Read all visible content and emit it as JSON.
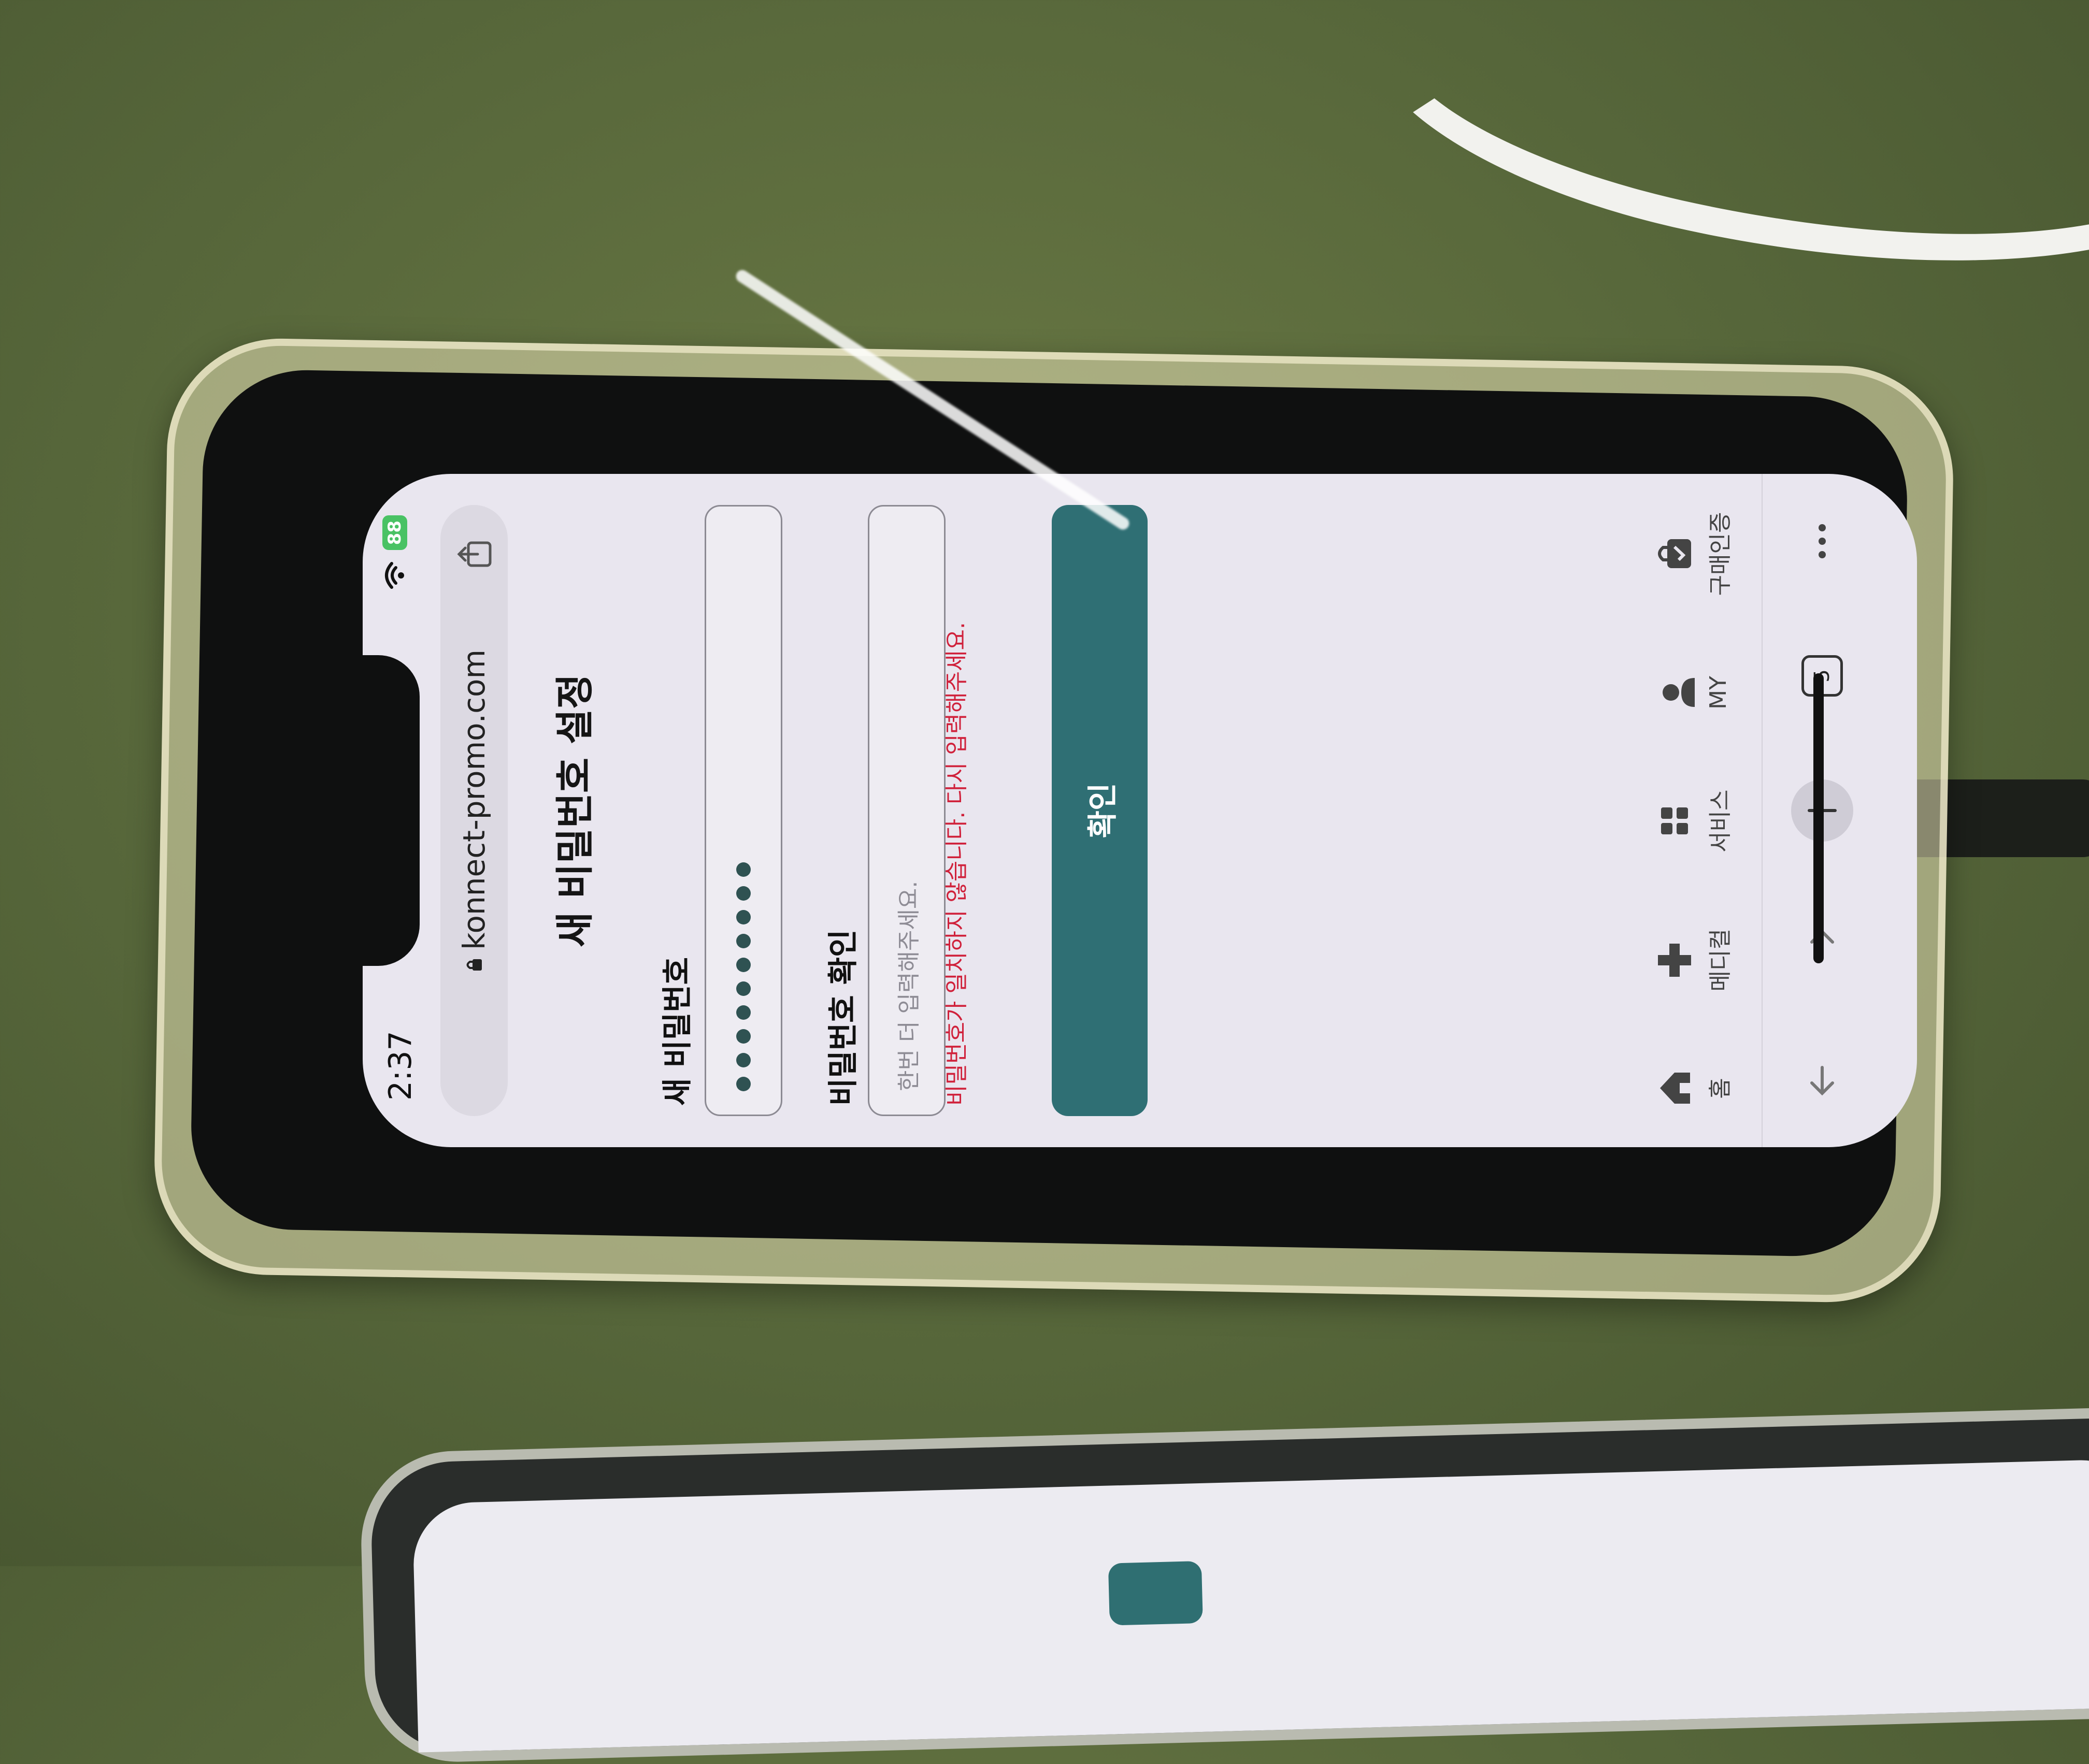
{
  "status_bar": {
    "time": "2:37",
    "battery": "88"
  },
  "browser": {
    "url": "konnect-promo.com",
    "tab_count": "5"
  },
  "page": {
    "title": "새 비밀번호 설정",
    "new_password_label": "새 비밀번호",
    "new_password_masked_length": 10,
    "confirm_password_label": "비밀번호 확인",
    "confirm_placeholder": "한번 더 입력해주세요.",
    "error_message": "비밀번호가 일치하지 않습니다. 다시 입력해주세요.",
    "confirm_button": "확인"
  },
  "bottom_nav": [
    {
      "label": "홈",
      "icon": "home-icon"
    },
    {
      "label": "메디컬",
      "icon": "medical-cross-icon"
    },
    {
      "label": "서비스",
      "icon": "grid-icon"
    },
    {
      "label": "MY",
      "icon": "person-icon"
    },
    {
      "label": "구매인증",
      "icon": "shopping-bag-icon"
    }
  ],
  "colors": {
    "primary": "#2f6f74",
    "error": "#d0213b",
    "battery": "#49c264"
  }
}
